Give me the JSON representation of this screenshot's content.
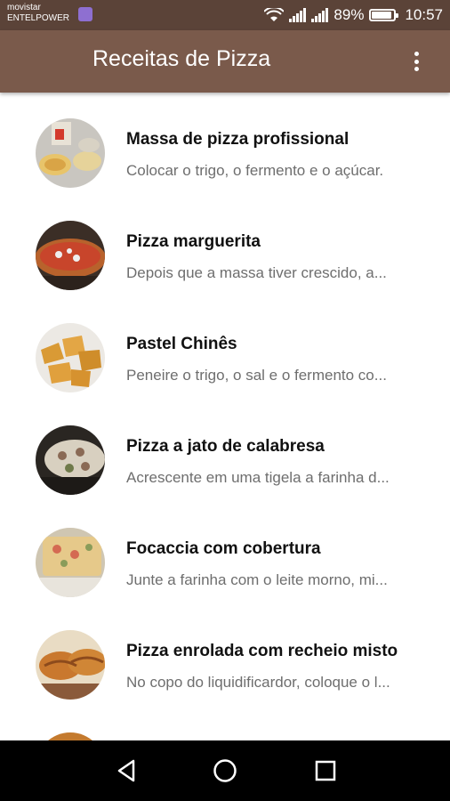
{
  "status": {
    "carrier_line1": "movistar",
    "carrier_line2": "ENTELPOWER",
    "battery_percent": "89%",
    "battery_level": 0.89,
    "time": "10:57",
    "icons": [
      "wifi-icon",
      "signal-icon",
      "signal-icon",
      "battery-icon"
    ]
  },
  "app_bar": {
    "title": "Receitas de Pizza",
    "menu_icon": "more-vert-icon"
  },
  "recipes": [
    {
      "title": "Massa de pizza profissional",
      "description": "Colocar o trigo, o fermento e o açúcar."
    },
    {
      "title": "Pizza marguerita",
      "description": "Depois que a massa tiver crescido, a..."
    },
    {
      "title": "Pastel Chinês",
      "description": "Peneire o trigo, o sal e o fermento co..."
    },
    {
      "title": "Pizza a jato de calabresa",
      "description": "Acrescente em uma tigela a farinha d..."
    },
    {
      "title": "Focaccia com cobertura",
      "description": "Junte a farinha com o leite morno, mi..."
    },
    {
      "title": "Pizza enrolada com recheio misto",
      "description": "No copo do liquidificardor, coloque o l..."
    }
  ],
  "nav": {
    "back": "back-icon",
    "home": "home-icon",
    "recents": "recents-icon"
  },
  "colors": {
    "status_bar": "#5b4338",
    "app_bar": "#7a5a4b",
    "title_text": "#111111",
    "desc_text": "#6e6e6e"
  }
}
